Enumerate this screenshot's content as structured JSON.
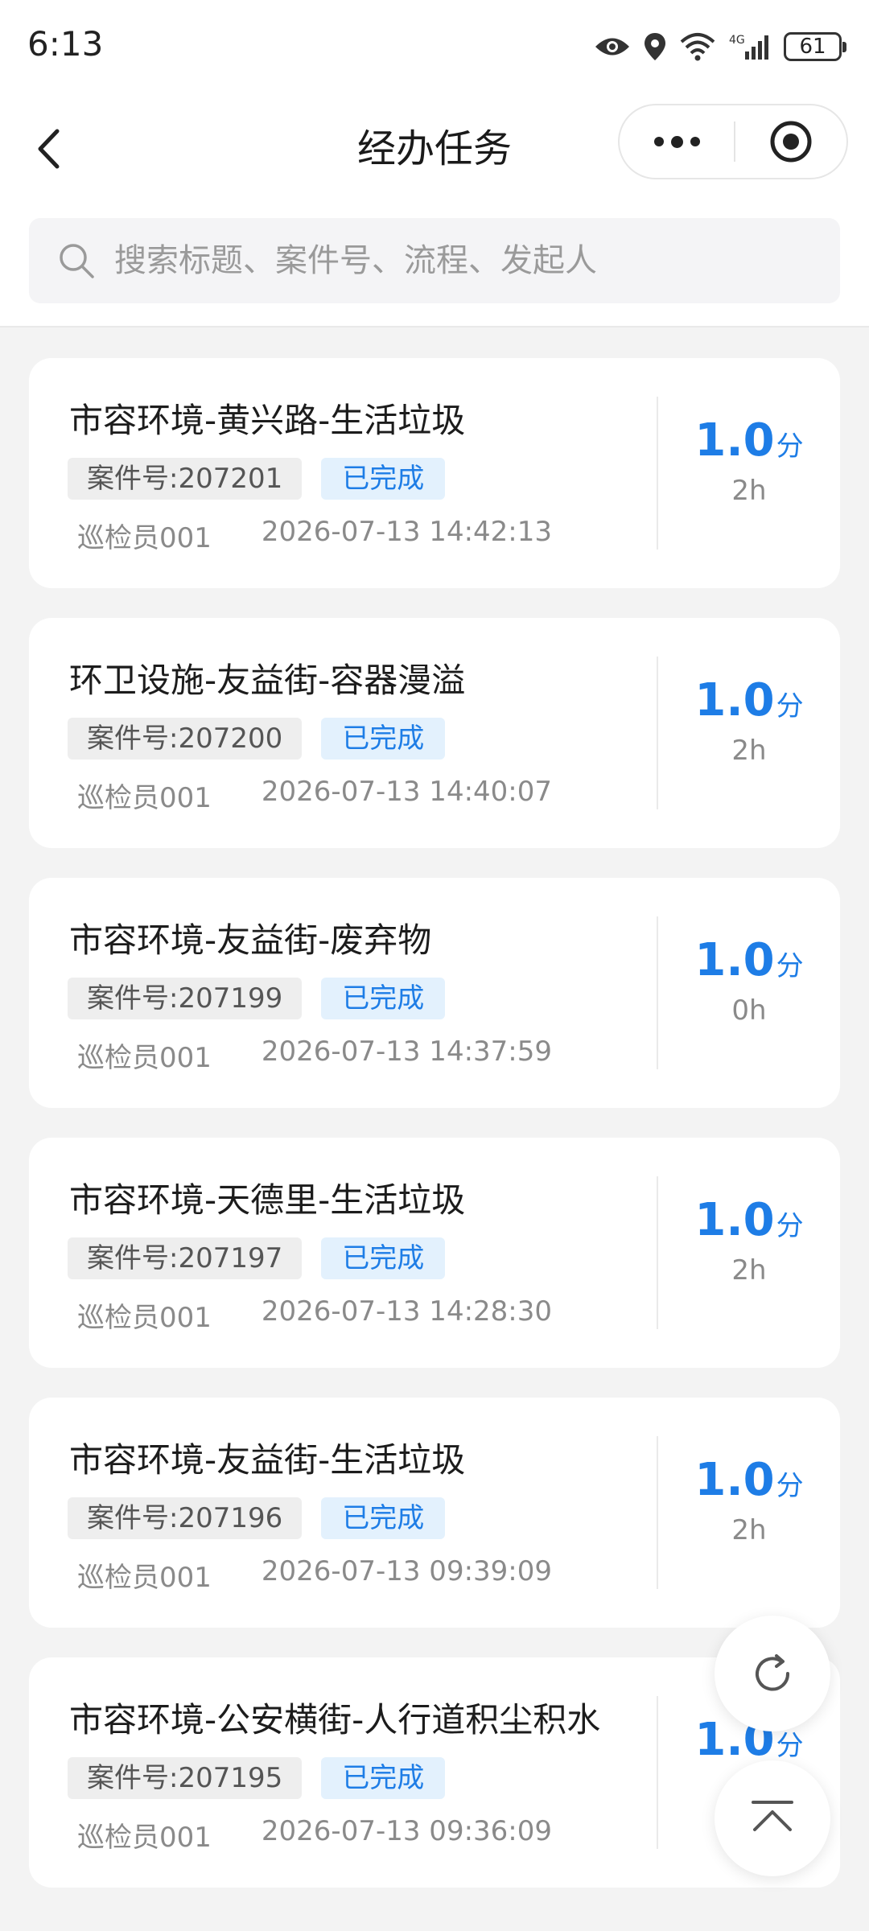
{
  "status_bar": {
    "time": "6:13",
    "network": "4G",
    "battery": "61"
  },
  "header": {
    "title": "经办任务"
  },
  "search": {
    "placeholder": "搜索标题、案件号、流程、发起人",
    "value": ""
  },
  "colors": {
    "accent": "#1e7de6",
    "status_bg": "#e3f1fd",
    "page_bg": "#f3f3f3"
  },
  "tasks": [
    {
      "title": "市容环境-黄兴路-生活垃圾",
      "case_no": "案件号:207201",
      "status": "已完成",
      "inspector": "巡检员001",
      "time": "2026-07-13 14:42:13",
      "score": "1.0",
      "score_unit": "分",
      "duration": "2h"
    },
    {
      "title": "环卫设施-友益街-容器漫溢",
      "case_no": "案件号:207200",
      "status": "已完成",
      "inspector": "巡检员001",
      "time": "2026-07-13 14:40:07",
      "score": "1.0",
      "score_unit": "分",
      "duration": "2h"
    },
    {
      "title": "市容环境-友益街-废弃物",
      "case_no": "案件号:207199",
      "status": "已完成",
      "inspector": "巡检员001",
      "time": "2026-07-13 14:37:59",
      "score": "1.0",
      "score_unit": "分",
      "duration": "0h"
    },
    {
      "title": "市容环境-天德里-生活垃圾",
      "case_no": "案件号:207197",
      "status": "已完成",
      "inspector": "巡检员001",
      "time": "2026-07-13 14:28:30",
      "score": "1.0",
      "score_unit": "分",
      "duration": "2h"
    },
    {
      "title": "市容环境-友益街-生活垃圾",
      "case_no": "案件号:207196",
      "status": "已完成",
      "inspector": "巡检员001",
      "time": "2026-07-13 09:39:09",
      "score": "1.0",
      "score_unit": "分",
      "duration": "2h"
    },
    {
      "title": "市容环境-公安横街-人行道积尘积水",
      "case_no": "案件号:207195",
      "status": "已完成",
      "inspector": "巡检员001",
      "time": "2026-07-13 09:36:09",
      "score": "1.0",
      "score_unit": "分",
      "duration": ""
    }
  ],
  "icons": {
    "back": "chevron-left-icon",
    "more": "more-dots-icon",
    "close": "target-close-icon",
    "search": "search-icon",
    "refresh": "refresh-icon",
    "back_to_top": "back-to-top-icon"
  }
}
